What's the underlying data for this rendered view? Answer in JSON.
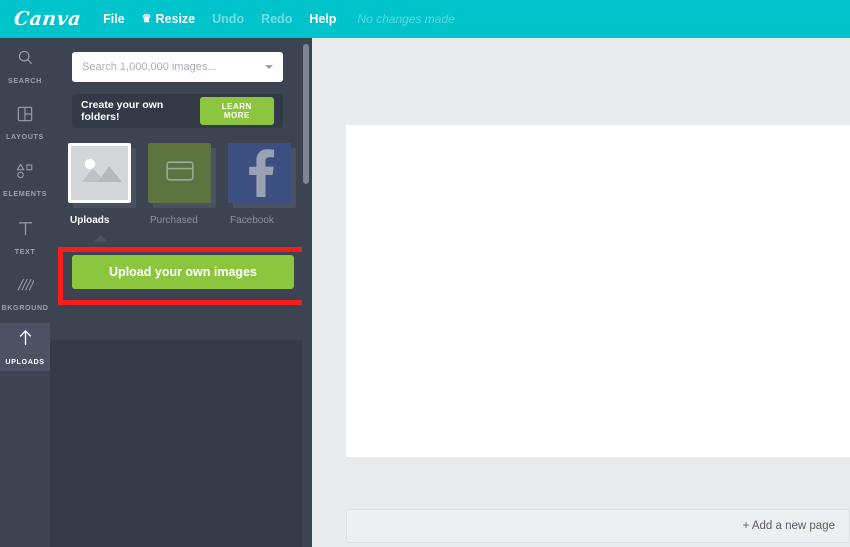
{
  "topbar": {
    "logo": "Canva",
    "menu": [
      {
        "label": "File",
        "dim": false,
        "icon": ""
      },
      {
        "label": "Resize",
        "dim": false,
        "icon": "crown-icon"
      },
      {
        "label": "Undo",
        "dim": true,
        "icon": ""
      },
      {
        "label": "Redo",
        "dim": true,
        "icon": ""
      },
      {
        "label": "Help",
        "dim": false,
        "icon": ""
      }
    ],
    "file_label": "File",
    "resize_label": "Resize",
    "undo_label": "Undo",
    "redo_label": "Redo",
    "help_label": "Help",
    "status": "No changes made",
    "accent_color": "#00c4cc"
  },
  "rail": {
    "items": [
      {
        "label": "SEARCH",
        "icon": "search-icon",
        "active": false
      },
      {
        "label": "LAYOUTS",
        "icon": "layouts-icon",
        "active": false
      },
      {
        "label": "ELEMENTS",
        "icon": "elements-icon",
        "active": false
      },
      {
        "label": "TEXT",
        "icon": "text-icon",
        "active": false
      },
      {
        "label": "BKGROUND",
        "icon": "background-icon",
        "active": false
      },
      {
        "label": "UPLOADS",
        "icon": "upload-arrow-icon",
        "active": true
      }
    ]
  },
  "panel": {
    "search": {
      "placeholder": "Search 1,000,000 images...",
      "value": ""
    },
    "folders_banner": {
      "text": "Create your own folders!",
      "button_label": "LEARN MORE",
      "button_color": "#8cc63f"
    },
    "folders": [
      {
        "name": "Uploads",
        "icon": "image-placeholder-icon",
        "selected": true,
        "color": "#d4d6da"
      },
      {
        "name": "Purchased",
        "icon": "credit-card-icon",
        "selected": false,
        "color": "#5d7340"
      },
      {
        "name": "Facebook",
        "icon": "facebook-icon",
        "selected": false,
        "color": "#3b5080"
      }
    ],
    "upload_button": {
      "label": "Upload your own images",
      "color": "#8cc63f",
      "highlight_color": "#f91c1c"
    }
  },
  "workspace": {
    "add_page_label": "+ Add a new page"
  }
}
